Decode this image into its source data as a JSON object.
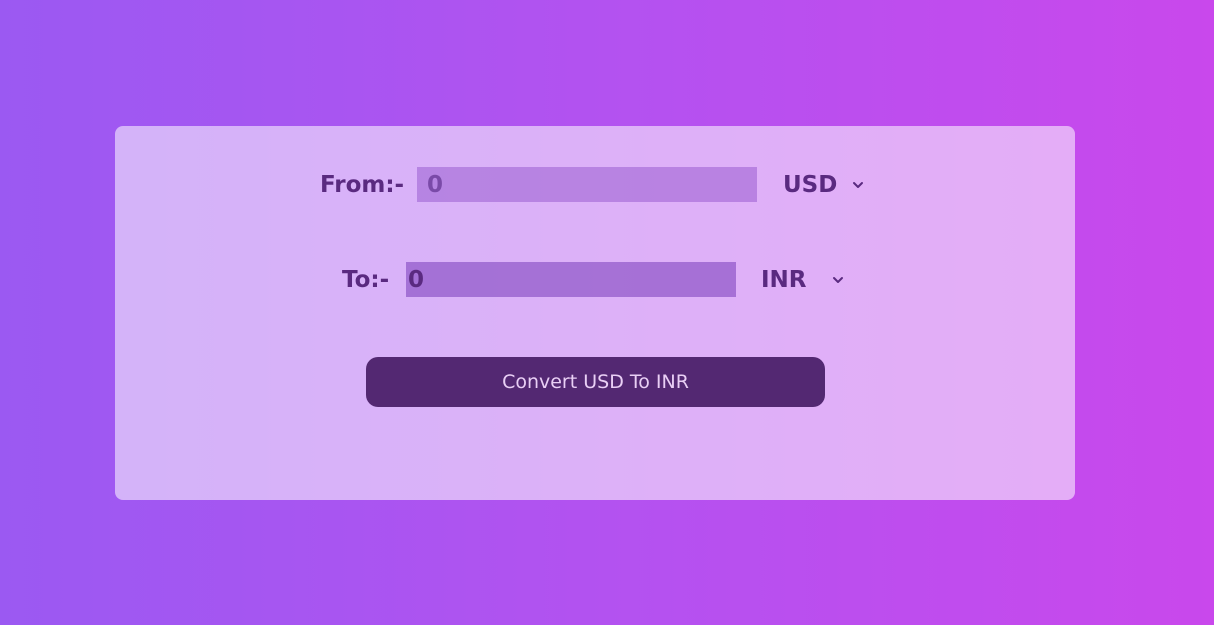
{
  "form": {
    "from": {
      "label": "From:-",
      "amount": "0",
      "currency": "USD"
    },
    "to": {
      "label": "To:-",
      "amount": "0",
      "currency": "INR"
    },
    "convert_label": "Convert USD To INR"
  },
  "icons": {
    "dropdown": "chevron-down-icon"
  },
  "colors": {
    "text": "#5a2a80",
    "button_bg": "#532872",
    "button_text": "#e9cff5"
  }
}
